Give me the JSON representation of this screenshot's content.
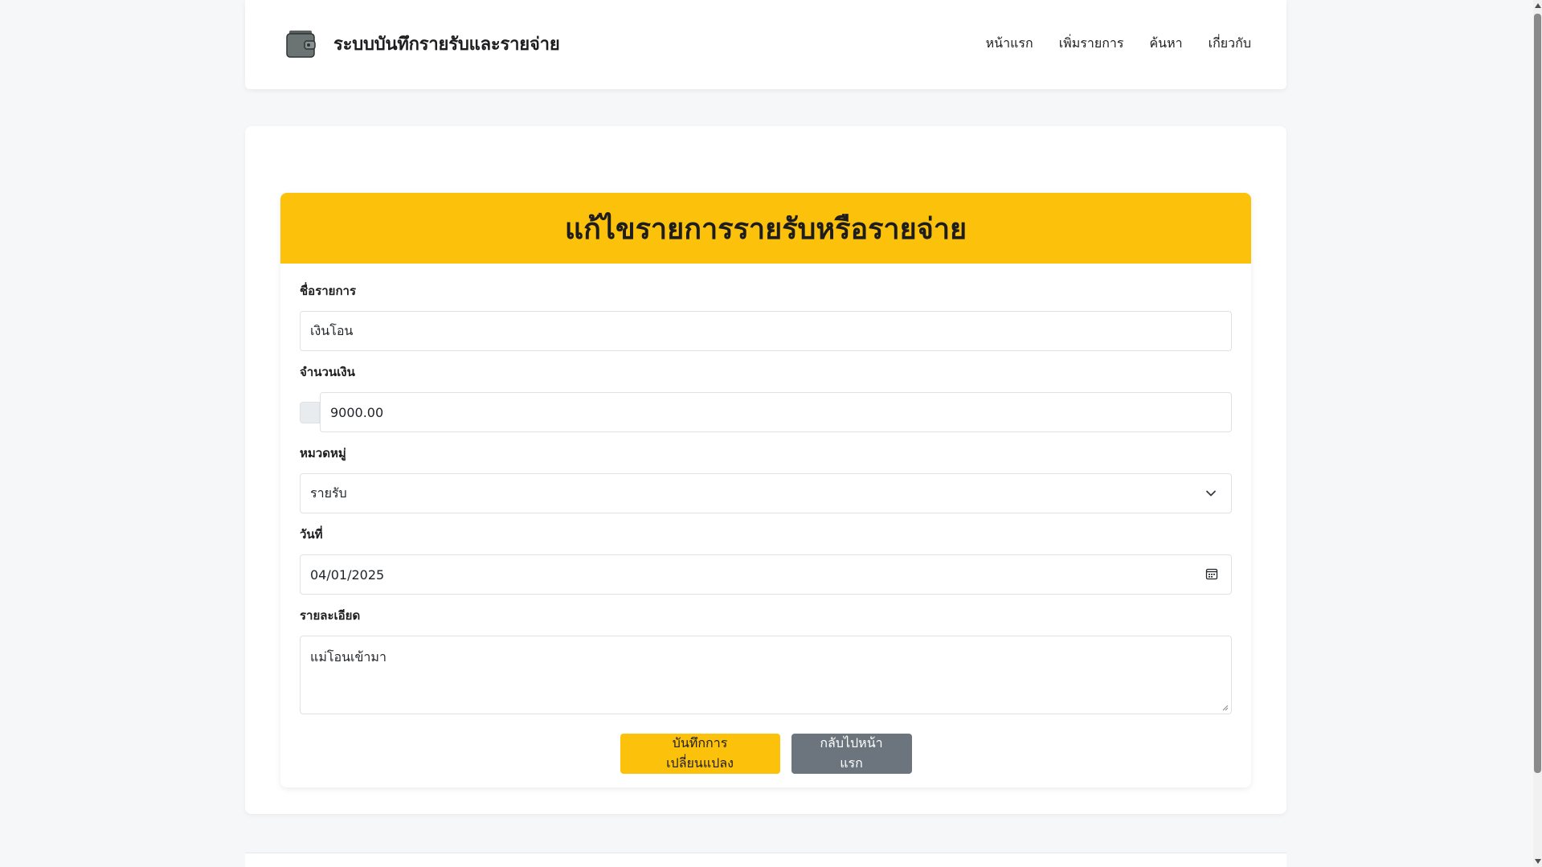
{
  "header": {
    "brand_title": "ระบบบันทึกรายรับและรายจ่าย",
    "brand_icon": "wallet-icon",
    "nav": [
      {
        "label": "หน้าแรก"
      },
      {
        "label": "เพิ่มรายการ"
      },
      {
        "label": "ค้นหา"
      },
      {
        "label": "เกี่ยวกับ"
      }
    ]
  },
  "form": {
    "title": "แก้ไขรายการรายรับหรือรายจ่าย",
    "name_label": "ชื่อรายการ",
    "name_value": "เงินโอน",
    "amount_label": "จำนวนเงิน",
    "amount_value": "9000.00",
    "category_label": "หมวดหมู่",
    "category_value": "รายรับ",
    "date_label": "วันที่",
    "date_value": "04/01/2025",
    "details_label": "รายละเอียด",
    "details_value": "แม่โอนเข้ามา",
    "save_label": "บันทึกการเปลี่ยนแปลง",
    "back_label": "กลับไปหน้าแรก"
  },
  "colors": {
    "accent": "#fcc10b",
    "secondary": "#6c757d",
    "background": "#f6f7f9"
  }
}
